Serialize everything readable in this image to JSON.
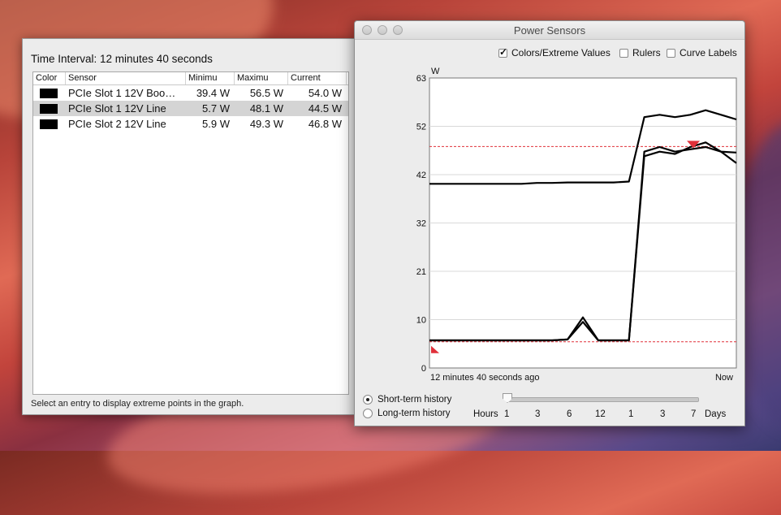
{
  "left_panel": {
    "time_interval": "Time Interval: 12 minutes 40 seconds",
    "columns": [
      "Color",
      "Sensor",
      "Minimu",
      "Maximu",
      "Current"
    ],
    "rows": [
      {
        "sensor": "PCIe Slot 1 12V Boo…",
        "min": "39.4 W",
        "max": "56.5 W",
        "current": "54.0 W",
        "selected": false
      },
      {
        "sensor": "PCIe Slot 1 12V Line",
        "min": "5.7 W",
        "max": "48.1 W",
        "current": "44.5 W",
        "selected": true
      },
      {
        "sensor": "PCIe Slot 2 12V Line",
        "min": "5.9 W",
        "max": "49.3 W",
        "current": "46.8 W",
        "selected": false
      }
    ],
    "status": "Select an entry to display extreme points in the graph."
  },
  "window": {
    "title": "Power Sensors",
    "options": {
      "colors_extreme": {
        "label": "Colors/Extreme Values",
        "checked": true
      },
      "rulers": {
        "label": "Rulers",
        "checked": false
      },
      "curve_labels": {
        "label": "Curve Labels",
        "checked": false
      }
    },
    "history": {
      "short_term": "Short-term history",
      "long_term": "Long-term history",
      "selected": "short_term",
      "hours_label": "Hours",
      "days_label": "Days",
      "scale": [
        "1",
        "3",
        "6",
        "12",
        "1",
        "3",
        "7"
      ]
    }
  },
  "chart_data": {
    "type": "line",
    "ylabel": "W",
    "yticks": [
      "63",
      "52",
      "42",
      "32",
      "21",
      "10",
      "0"
    ],
    "ylim": [
      0,
      63
    ],
    "x_start_label": "12 minutes 40 seconds ago",
    "x_end_label": "Now",
    "extreme_line_max": 48.1,
    "extreme_line_min": 5.7,
    "series": [
      {
        "values": [
          40.0,
          40.0,
          40.0,
          40.0,
          40.0,
          40.0,
          40.0,
          40.2,
          40.2,
          40.3,
          40.3,
          40.3,
          40.3,
          40.5,
          54.5,
          55.0,
          54.5,
          55.0,
          56.0,
          55.0,
          54.0
        ]
      },
      {
        "values": [
          6.0,
          6.0,
          6.0,
          6.0,
          6.0,
          6.0,
          6.0,
          6.0,
          6.0,
          6.2,
          11.0,
          6.0,
          6.0,
          6.0,
          47.0,
          48.0,
          47.0,
          47.5,
          48.0,
          47.0,
          44.5
        ]
      },
      {
        "values": [
          6.0,
          6.0,
          6.0,
          6.0,
          6.0,
          6.0,
          6.0,
          6.0,
          6.0,
          6.2,
          10.0,
          6.0,
          6.0,
          6.0,
          46.0,
          47.0,
          46.5,
          48.0,
          49.0,
          47.0,
          46.8
        ]
      }
    ]
  }
}
